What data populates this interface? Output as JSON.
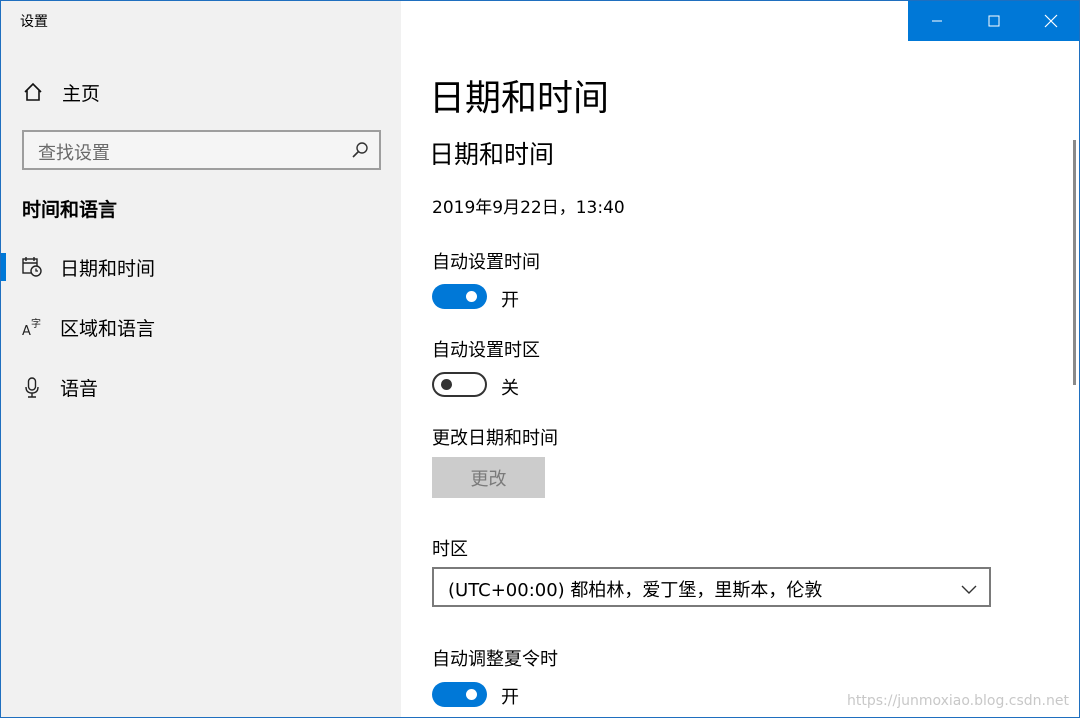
{
  "window": {
    "title": "设置"
  },
  "sidebar": {
    "home_label": "主页",
    "search_placeholder": "查找设置",
    "section_title": "时间和语言",
    "items": [
      {
        "label": "日期和时间",
        "icon": "calendar-clock-icon",
        "active": true
      },
      {
        "label": "区域和语言",
        "icon": "region-language-icon",
        "active": false
      },
      {
        "label": "语音",
        "icon": "microphone-icon",
        "active": false
      }
    ]
  },
  "main": {
    "page_title": "日期和时间",
    "section_title": "日期和时间",
    "current_datetime": "2019年9月22日，13:40",
    "auto_time": {
      "label": "自动设置时间",
      "state_label": "开",
      "on": true
    },
    "auto_timezone": {
      "label": "自动设置时区",
      "state_label": "关",
      "on": false
    },
    "change_datetime": {
      "label": "更改日期和时间",
      "button_label": "更改"
    },
    "timezone": {
      "label": "时区",
      "value": "(UTC+00:00) 都柏林，爱丁堡，里斯本，伦敦"
    },
    "dst": {
      "label": "自动调整夏令时",
      "state_label": "开",
      "on": true
    }
  },
  "watermark": "https://junmoxiao.blog.csdn.net",
  "colors": {
    "accent": "#0078d7",
    "sidebar_bg": "#f1f1f1",
    "disabled_bg": "#cccccc"
  }
}
